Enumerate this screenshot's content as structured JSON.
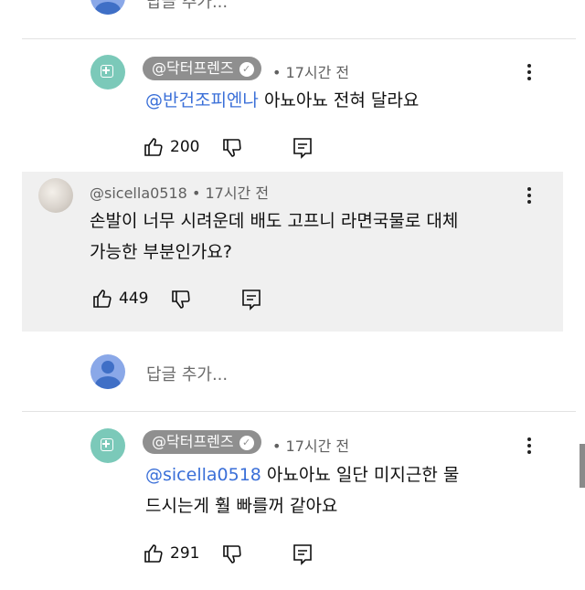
{
  "top_reply_input": {
    "placeholder": "답글 추가..."
  },
  "comments": [
    {
      "author": "@닥터프렌즈",
      "verified": true,
      "time": "• 17시간 전",
      "mention": "@반건조피엔나",
      "text": "아뇨아뇨 전혀 달라요",
      "likes": "200"
    },
    {
      "author": "@sicella0518",
      "time": "• 17시간 전",
      "text_lines": [
        "손발이 너무 시려운데 배도 고프니 라면국물로 대체",
        "가능한 부분인가요?"
      ],
      "likes": "449"
    },
    {
      "author": "@닥터프렌즈",
      "verified": true,
      "time": "• 17시간 전",
      "mention": "@sicella0518",
      "text_line1": "아뇨아뇨 일단 미지근한 물",
      "text_line2": "드시는게 훨 빠를꺼 같아요",
      "likes": "291"
    }
  ],
  "reply_input": {
    "placeholder": "답글 추가..."
  },
  "colors": {
    "mention": "#3a6fd8",
    "chip": "#8f8f8f",
    "avatar_green": "#7bc9b9",
    "highlight_bg": "#f0f0f0"
  }
}
